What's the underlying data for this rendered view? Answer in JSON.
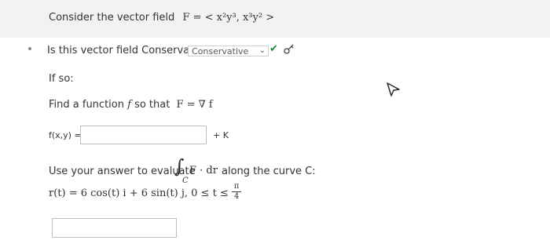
{
  "question": {
    "intro": "Consider the vector field",
    "field_formula": "F = < x²y³, x³y² >"
  },
  "part1": {
    "prompt": "Is this vector field Conservative?",
    "answer_select": "Conservative"
  },
  "if_so": "If so:",
  "part2": {
    "prompt": "Find a function",
    "f_symbol": "f",
    "so_that": "so that",
    "relation": "F = ∇ f",
    "label": "f(x,y) =",
    "input_value": "",
    "constant": "+ K"
  },
  "part3": {
    "prompt_start": "Use your answer to evaluate",
    "integral": "∫",
    "integral_sub": "C",
    "integrand": "F · dr",
    "prompt_end": "along the curve C:",
    "curve": "r(t) = 6 cos(t) i + 6 sin(t) j,  0 ≤ t ≤",
    "frac_num": "π",
    "frac_den": "4",
    "input_value": ""
  }
}
